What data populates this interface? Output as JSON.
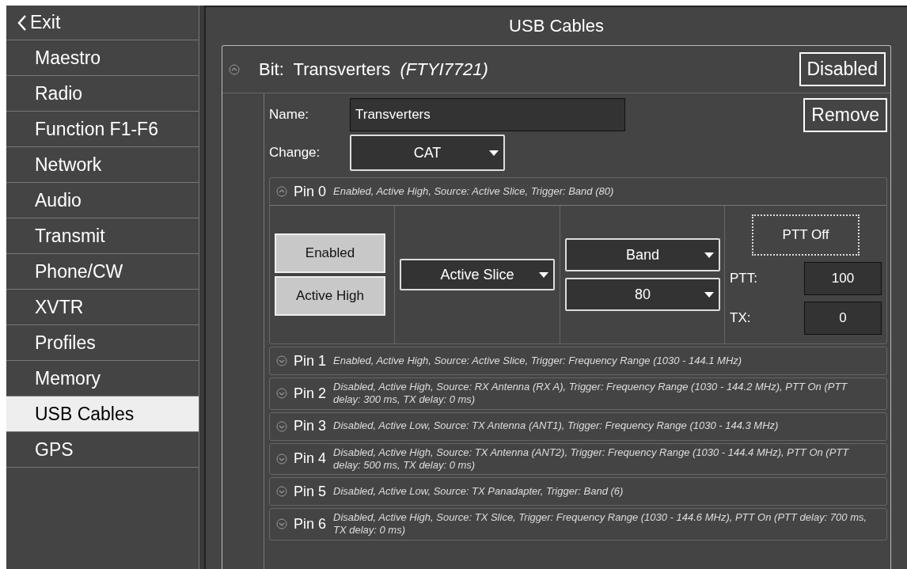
{
  "sidebar": {
    "exit": "Exit",
    "items": [
      {
        "label": "Maestro",
        "selected": false
      },
      {
        "label": "Radio",
        "selected": false
      },
      {
        "label": "Function F1-F6",
        "selected": false
      },
      {
        "label": "Network",
        "selected": false
      },
      {
        "label": "Audio",
        "selected": false
      },
      {
        "label": "Transmit",
        "selected": false
      },
      {
        "label": "Phone/CW",
        "selected": false
      },
      {
        "label": "XVTR",
        "selected": false
      },
      {
        "label": "Profiles",
        "selected": false
      },
      {
        "label": "Memory",
        "selected": false
      },
      {
        "label": "USB Cables",
        "selected": true
      },
      {
        "label": "GPS",
        "selected": false
      }
    ]
  },
  "title": "USB Cables",
  "bit": {
    "title": "Bit:  Transverters  *(FTYI7721)*",
    "expanded": true,
    "status_button": "Disabled",
    "remove_button": "Remove",
    "name_field": {
      "label": "Name:",
      "value": "Transverters"
    },
    "change_field": {
      "label": "Change:",
      "value": "CAT"
    },
    "pins": [
      {
        "label": "Pin 0",
        "summary": "Enabled, Active High, Source: Active Slice, Trigger: Band (80)",
        "expanded": true,
        "detail": {
          "toggles": [
            {
              "label": "Enabled"
            },
            {
              "label": "Active High"
            }
          ],
          "source": "Active Slice",
          "trigger": "Band",
          "trigger_value": "80",
          "ptt_button": "PTT Off",
          "ptt": {
            "label": "PTT:",
            "value": "100"
          },
          "tx": {
            "label": "TX:",
            "value": "0"
          }
        }
      },
      {
        "label": "Pin 1",
        "summary": "Enabled, Active High, Source: Active Slice, Trigger: Frequency Range (1030 - 144.1 MHz)",
        "expanded": false
      },
      {
        "label": "Pin 2",
        "summary": "Disabled, Active High, Source: RX Antenna (RX A), Trigger: Frequency Range (1030 - 144.2 MHz), PTT On (PTT delay: 300 ms, TX delay: 0 ms)",
        "expanded": false
      },
      {
        "label": "Pin 3",
        "summary": "Disabled, Active Low, Source: TX Antenna (ANT1), Trigger: Frequency Range (1030 - 144.3 MHz)",
        "expanded": false
      },
      {
        "label": "Pin 4",
        "summary": "Disabled, Active High, Source: TX Antenna (ANT2), Trigger: Frequency Range (1030 - 144.4 MHz), PTT On (PTT delay: 500 ms, TX delay: 0 ms)",
        "expanded": false
      },
      {
        "label": "Pin 5",
        "summary": "Disabled, Active Low, Source: TX Panadapter, Trigger: Band (6)",
        "expanded": false
      },
      {
        "label": "Pin 6",
        "summary": "Disabled, Active High, Source: TX Slice, Trigger: Frequency Range (1030 - 144.6 MHz), PTT On (PTT delay: 700 ms, TX delay: 0 ms)",
        "expanded": false
      }
    ]
  }
}
